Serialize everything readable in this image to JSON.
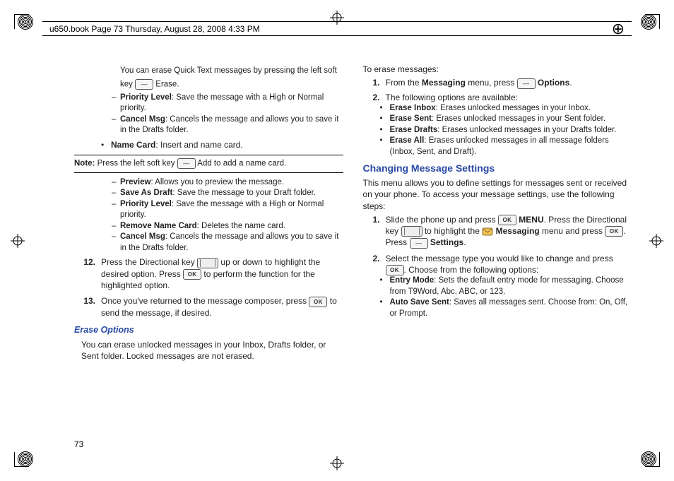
{
  "header": {
    "running": "u650.book  Page 73  Thursday, August 28, 2008  4:33 PM"
  },
  "page_number": "73",
  "left": {
    "p_quicktext_a": "You can erase Quick Text messages by pressing the left soft",
    "p_quicktext_b": "key ",
    "p_quicktext_c": " Erase.",
    "d_priority_b": "Priority Level",
    "d_priority_t": ": Save the message with a High or Normal priority.",
    "d_cancel_b": "Cancel Msg",
    "d_cancel_t": ": Cancels the message and allows you to save it in the Drafts folder.",
    "bul_name_b": "Name Card",
    "bul_name_t": ": Insert and name card.",
    "note_label": "Note:",
    "note_a": " Press the left soft key ",
    "note_b": " Add to add a name card.",
    "d_preview_b": "Preview",
    "d_preview_t": ": Allows you to preview the message.",
    "d_savedraft_b": "Save As Draft",
    "d_savedraft_t": ": Save the message to your Draft folder.",
    "d_priority2_b": "Priority Level",
    "d_priority2_t": ": Save the message with a High or Normal priority.",
    "d_remove_b": "Remove Name Card",
    "d_remove_t": ": Deletes the name card.",
    "d_cancel2_b": "Cancel Msg",
    "d_cancel2_t": ": Cancels the message and allows you to save it in the Drafts folder.",
    "s12_num": "12.",
    "s12_a": "Press the Directional key ",
    "s12_b": " up or down to highlight the desired option. Press ",
    "s12_c": " to perform the function for the highlighted option.",
    "s13_num": "13.",
    "s13_a": "Once you've returned to the message composer, press ",
    "s13_b": " to send the message, if desired.",
    "sub_erase": "Erase Options",
    "p_erase": "You can erase unlocked messages in your Inbox, Drafts folder, or Sent folder. Locked messages are not erased."
  },
  "right": {
    "p_to_erase": "To erase messages:",
    "s1_num": "1.",
    "s1_a": "From the ",
    "s1_b": "Messaging",
    "s1_c": " menu, press ",
    "s1_d": "Options",
    "s1_e": ".",
    "s2_num": "2.",
    "s2_a": "The following options are available:",
    "b_inbox_b": "Erase Inbox",
    "b_inbox_t": ": Erases unlocked messages in your Inbox.",
    "b_sent_b": "Erase Sent",
    "b_sent_t": ": Erases unlocked messages in your Sent folder.",
    "b_drafts_b": "Erase Drafts",
    "b_drafts_t": ": Erases unlocked messages in your Drafts folder.",
    "b_all_b": "Erase All",
    "b_all_t": ": Erases unlocked messages in all message folders (Inbox, Sent, and Draft).",
    "head_changing": "Changing Message Settings",
    "p_intro": "This menu allows you to define settings for messages sent or received on your phone. To access your message settings, use the following steps:",
    "cs1_num": "1.",
    "cs1_a": "Slide the phone up and press ",
    "cs1_b": "MENU",
    "cs1_c": ". Press the Directional key ",
    "cs1_d": " to highlight the ",
    "cs1_e": "Messaging",
    "cs1_f": " menu and press ",
    "cs1_g": ". Press ",
    "cs1_h": "Settings",
    "cs1_i": ".",
    "cs2_num": "2.",
    "cs2_a": "Select the message type you would like to change and press ",
    "cs2_b": ". Choose from the following options:",
    "b_entry_b": "Entry Mode",
    "b_entry_t": ": Sets the default entry mode for messaging. Choose from T9Word, Abc, ABC, or 123.",
    "b_auto_b": "Auto Save Sent",
    "b_auto_t": ": Saves all messages sent. Choose from: On, Off, or Prompt."
  }
}
